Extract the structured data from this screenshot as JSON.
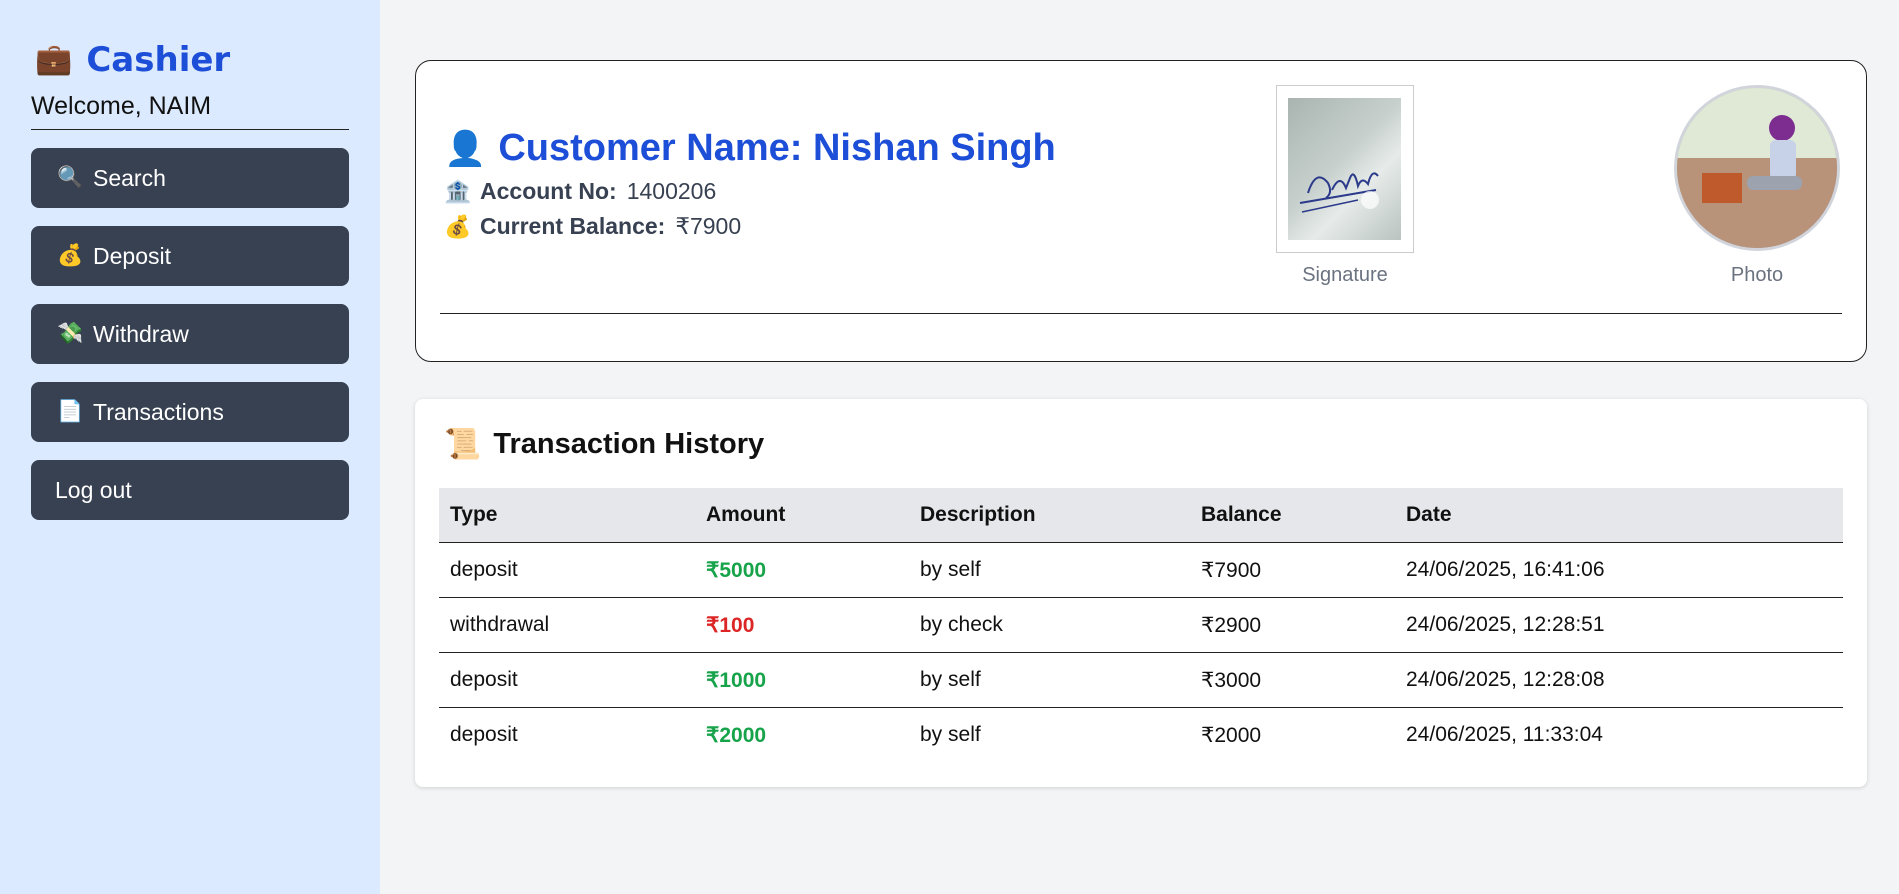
{
  "sidebar": {
    "brand_icon": "💼",
    "title": "Cashier",
    "welcome": "Welcome, NAIM",
    "items": [
      {
        "icon": "🔍",
        "label": "Search"
      },
      {
        "icon": "💰",
        "label": "Deposit"
      },
      {
        "icon": "💸",
        "label": "Withdraw"
      },
      {
        "icon": "📄",
        "label": "Transactions"
      },
      {
        "label": "Log out"
      }
    ]
  },
  "customer": {
    "icon": "👤",
    "name": "Customer Name: Nishan Singh",
    "account_label": "Account No:",
    "account_no": "1400206",
    "account_icon": "🏦",
    "balance_label": "Current Balance:",
    "balance": "₹7900",
    "balance_icon": "💰",
    "signature_label": "Signature",
    "photo_label": "Photo"
  },
  "history": {
    "icon": "📜",
    "title": "Transaction History",
    "columns": [
      "Type",
      "Amount",
      "Description",
      "Balance",
      "Date"
    ],
    "rows": [
      {
        "type": "deposit",
        "amount": "₹5000",
        "description": "by self",
        "balance": "₹7900",
        "date": "24/06/2025, 16:41:06"
      },
      {
        "type": "withdrawal",
        "amount": "₹100",
        "description": "by check",
        "balance": "₹2900",
        "date": "24/06/2025, 12:28:51"
      },
      {
        "type": "deposit",
        "amount": "₹1000",
        "description": "by self",
        "balance": "₹3000",
        "date": "24/06/2025, 12:28:08"
      },
      {
        "type": "deposit",
        "amount": "₹2000",
        "description": "by self",
        "balance": "₹2000",
        "date": "24/06/2025, 11:33:04"
      }
    ]
  },
  "colors": {
    "accent": "#1d4ed8",
    "sidebar_bg": "#dbeafe",
    "button_bg": "#374151",
    "deposit": "#16a34a",
    "withdrawal": "#dc2626"
  }
}
